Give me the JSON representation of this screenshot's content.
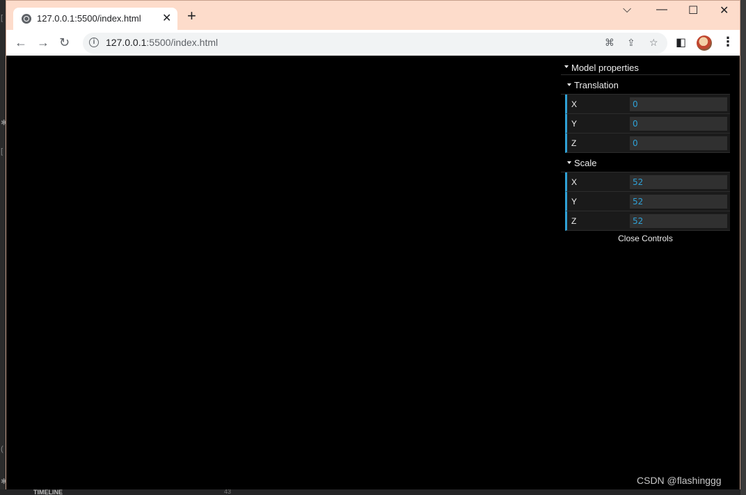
{
  "tab": {
    "title": "127.0.0.1:5500/index.html"
  },
  "address": {
    "host": "127.0.0.1",
    "rest": ":5500/index.html"
  },
  "gui": {
    "root_title": "Model properties",
    "folders": [
      {
        "title": "Translation",
        "rows": [
          {
            "label": "X",
            "value": "0"
          },
          {
            "label": "Y",
            "value": "0"
          },
          {
            "label": "Z",
            "value": "0"
          }
        ]
      },
      {
        "title": "Scale",
        "rows": [
          {
            "label": "X",
            "value": "52"
          },
          {
            "label": "Y",
            "value": "52"
          },
          {
            "label": "Z",
            "value": "52"
          }
        ]
      }
    ],
    "close_label": "Close Controls"
  },
  "background": {
    "timeline_label": "TIMELINE",
    "line_number": "43"
  },
  "watermark": "CSDN @flashinggg",
  "colors": {
    "titlebar": "#fddccb",
    "accent": "#2fa1d6",
    "viewport": "#000000"
  },
  "icons": [
    "globe-icon",
    "close-icon",
    "plus-icon",
    "chevron-down-icon",
    "minimize-icon",
    "maximize-icon",
    "back-arrow-icon",
    "forward-arrow-icon",
    "reload-icon",
    "info-icon",
    "translate-icon",
    "share-icon",
    "star-icon",
    "side-panel-icon",
    "kebab-menu-icon"
  ]
}
